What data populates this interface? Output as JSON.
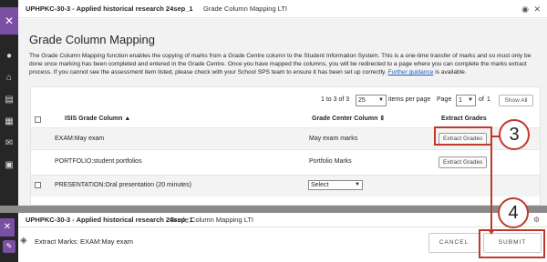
{
  "top_window": {
    "course_title": "UPHPKC-30-3 - Applied historical research 24sep_1",
    "tool_title": "Grade Column Mapping LTI",
    "page_title": "Grade Column Mapping",
    "description_pre": "The Grade Column Mapping function enables the copying of marks from a Grade Centre column to the Student Information System. This is a one-time transfer of marks and so must only be done once marking has been completed and entered in the Grade Centre. Once you have mapped the columns, you will be redirected to a page where you can complete the marks extract process. If you cannot see the assessment item listed, please check with your School SPS team to ensure it has been set up correctly. ",
    "description_link": "Further guidance",
    "description_post": " is available.",
    "pager": {
      "range": "1 to 3 of 3",
      "per_page_value": "25",
      "items_per_page_label": "items per page",
      "page_label": "Page",
      "page_value": "1",
      "of_label": "of",
      "total_pages": "1",
      "prev": "<",
      "next": ">",
      "show_all": "Show All"
    },
    "columns": {
      "isis": "ISIS Grade Column",
      "grade_center": "Grade Center Column",
      "extract": "Extract Grades"
    },
    "rows": [
      {
        "isis": "EXAM:May exam",
        "grade_center": "May exam marks",
        "action": "Extract Grades"
      },
      {
        "isis": "PORTFOLIO:student portfolios",
        "grade_center": "Portfolio Marks",
        "action": "Extract Grades"
      },
      {
        "isis": "PRESENTATION:Oral presentation (20 minutes)",
        "grade_center": "Select",
        "action": ""
      }
    ]
  },
  "bottom_window": {
    "course_title": "UPHPKC-30-3 - Applied historical research 24sep_1",
    "tool_title": "Grade Column Mapping LTI",
    "heading": "Extract Marks: EXAM:May exam",
    "cancel_label": "CANCEL",
    "submit_label": "SUBMIT"
  },
  "annotations": {
    "step3": "3",
    "step4": "4",
    "color": "#c0392b"
  },
  "colors": {
    "accent": "#7b4fa3",
    "sidebar": "#262626",
    "link": "#1a5fc4"
  },
  "icons": [
    "close-icon",
    "user-icon",
    "institution-icon",
    "courses-icon",
    "calendar-icon",
    "messages-icon",
    "grades-icon",
    "eye-icon",
    "gear-icon",
    "sort-asc-icon",
    "sort-both-icon"
  ]
}
